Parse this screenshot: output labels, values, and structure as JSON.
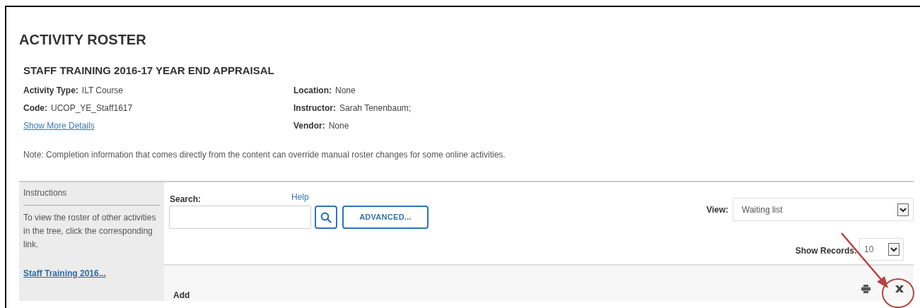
{
  "page_title": "ACTIVITY ROSTER",
  "activity_title": "STAFF TRAINING 2016-17 YEAR END APPRAISAL",
  "details_left": [
    {
      "label": "Activity Type:",
      "value": "ILT Course"
    },
    {
      "label": "Code:",
      "value": "UCOP_YE_Staff1617"
    }
  ],
  "show_more_link": "Show More Details",
  "details_right": [
    {
      "label": "Location:",
      "value": "None"
    },
    {
      "label": "Instructor:",
      "value": "Sarah Tenenbaum;"
    },
    {
      "label": "Vendor:",
      "value": "None"
    }
  ],
  "note": "Note: Completion information that comes directly from the content can override manual roster changes for some online activities.",
  "sidebar": {
    "heading": "Instructions",
    "text": "To view the roster of other activities in the tree, click the corresponding link.",
    "link": "Staff Training 2016..."
  },
  "search": {
    "label": "Search:",
    "help": "Help",
    "advanced_button": "ADVANCED..."
  },
  "view": {
    "label": "View:",
    "value": "Waiting list"
  },
  "show_records": {
    "label": "Show Records:",
    "value": "10"
  },
  "toolbar": {
    "add_label": "Add"
  }
}
